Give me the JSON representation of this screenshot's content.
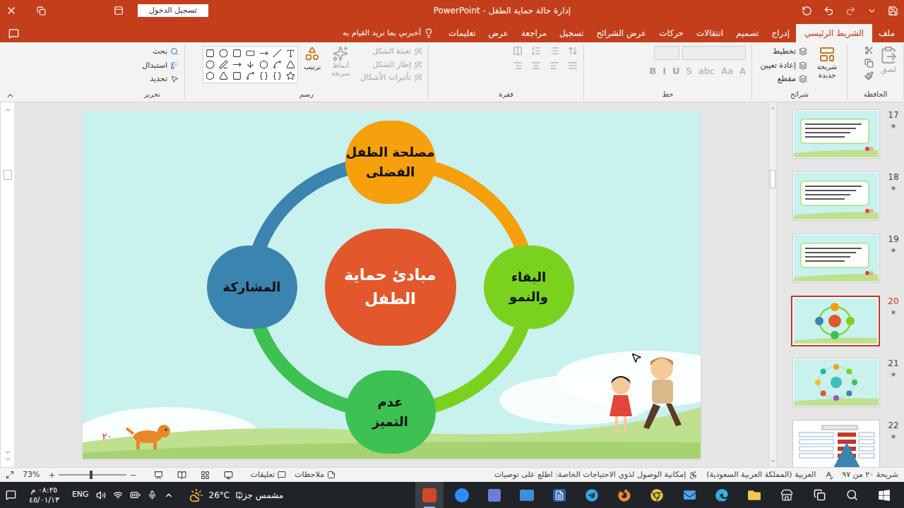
{
  "window": {
    "title": "إدارة حالة حماية الطفل - PowerPoint",
    "sign_in": "تسجيل الدخول"
  },
  "tabs": [
    {
      "label": "ملف",
      "selected": false
    },
    {
      "label": "الشريط الرئيسي",
      "selected": true
    },
    {
      "label": "إدراج",
      "selected": false
    },
    {
      "label": "تصميم",
      "selected": false
    },
    {
      "label": "انتقالات",
      "selected": false
    },
    {
      "label": "حركات",
      "selected": false
    },
    {
      "label": "عرض الشرائح",
      "selected": false
    },
    {
      "label": "تسجيل",
      "selected": false
    },
    {
      "label": "مراجعة",
      "selected": false
    },
    {
      "label": "عرض",
      "selected": false
    },
    {
      "label": "تعليمات",
      "selected": false
    }
  ],
  "tell_me": "أخبرني بما تريد القيام به",
  "ribbon": {
    "clipboard": {
      "label": "الحافظة",
      "paste": "لصق",
      "paste_disabled": true
    },
    "slides": {
      "label": "شرائح",
      "new_slide": "شريحة جديدة",
      "items": [
        "تخطيط",
        "إعادة تعيين",
        "مقطع"
      ]
    },
    "font": {
      "label": "خط",
      "disabled": true,
      "buttons": [
        "A",
        "Aa",
        "abc",
        "S",
        "U",
        "I",
        "B"
      ]
    },
    "paragraph": {
      "label": "فقرة",
      "disabled": true
    },
    "drawing": {
      "label": "رسم",
      "arrange": "ترتيب",
      "quick_styles": "أنماط سريعة",
      "items": [
        {
          "label": "تعبئة الشكل",
          "disabled": true
        },
        {
          "label": "إطار الشكل",
          "disabled": true
        },
        {
          "label": "تأثيرات الأشكال",
          "disabled": true
        }
      ]
    },
    "editing": {
      "label": "تحرير",
      "items": [
        "بحث",
        "استبدال",
        "تحديد"
      ]
    }
  },
  "slide": {
    "center": {
      "lines": [
        "مبادئ حماية",
        "الطفل"
      ],
      "color": "#e2572b"
    },
    "nodes": [
      {
        "lines": [
          "مصلحة الطفل",
          "الفضلى"
        ],
        "color": "#f5a00c"
      },
      {
        "lines": [
          "البقاء",
          "والنمو"
        ],
        "color": "#7ad21e"
      },
      {
        "lines": [
          "عدم",
          "التميز"
        ],
        "color": "#3cc152"
      },
      {
        "lines": [
          "المشاركة"
        ],
        "color": "#3b84b0"
      }
    ],
    "number": "٢٠"
  },
  "thumbnails": [
    {
      "number": "17",
      "mark": "★",
      "kind": "text",
      "selected": false
    },
    {
      "number": "18",
      "mark": "★",
      "kind": "text",
      "selected": false
    },
    {
      "number": "19",
      "mark": "★",
      "kind": "text",
      "selected": false
    },
    {
      "number": "20",
      "mark": "★",
      "kind": "cycle",
      "selected": true
    },
    {
      "number": "21",
      "mark": "★",
      "kind": "ring",
      "selected": false
    },
    {
      "number": "22",
      "mark": "★",
      "kind": "pyramid",
      "selected": false
    }
  ],
  "status_bar": {
    "slide": "شريحة ٢٠ من ٩٧",
    "language": "العربية (المملكة العربية السعودية)",
    "accessibility": "إمكانية الوصول لذوي الاحتياجات الخاصة: اطلع على توصيات",
    "notes": "ملاحظات",
    "comments": "تعليقات",
    "zoom": "73%",
    "zoom_level": 0.45
  },
  "taskbar": {
    "weather_temp": "26°C",
    "weather_text": "مشمس جزئيًا",
    "language": "ENG",
    "time": "٠٨:٢٥ م",
    "date": "٤٥/٠١/١٣"
  }
}
